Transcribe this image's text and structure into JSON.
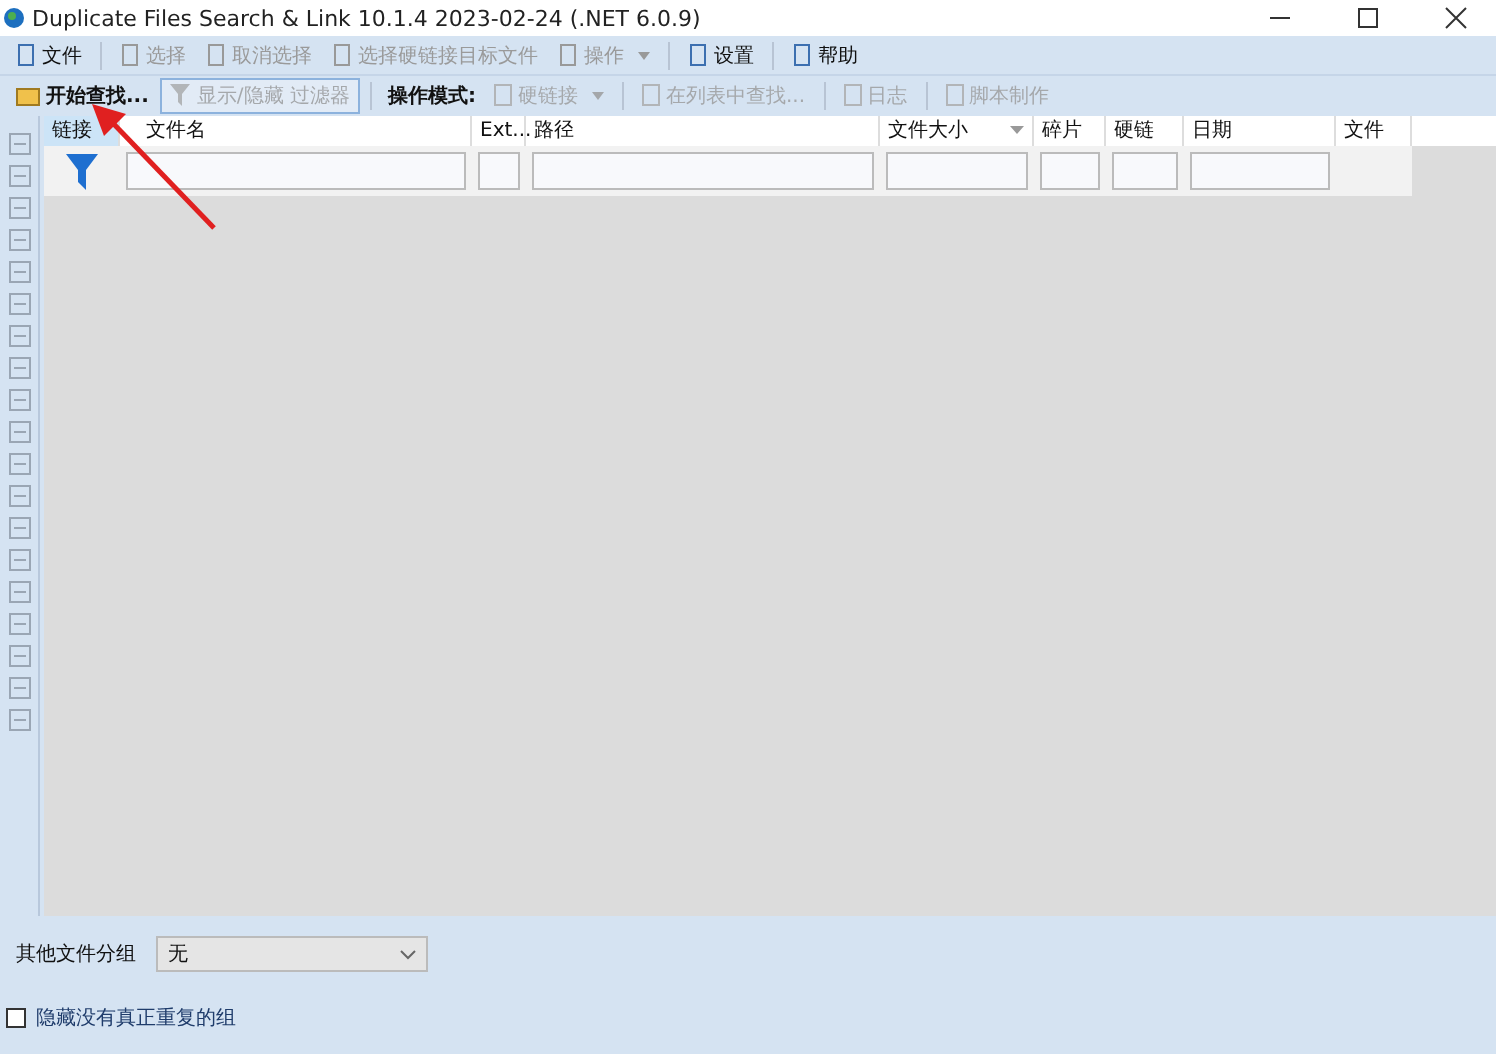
{
  "window": {
    "title": "Duplicate Files Search & Link 10.1.4 2023-02-24 (.NET 6.0.9)"
  },
  "menu": [
    {
      "label": "文件",
      "disabled": false,
      "dropdown": false
    },
    {
      "label": "选择",
      "disabled": true,
      "dropdown": false
    },
    {
      "label": "取消选择",
      "disabled": true,
      "dropdown": false
    },
    {
      "label": "选择硬链接目标文件",
      "disabled": true,
      "dropdown": false
    },
    {
      "label": "操作",
      "disabled": true,
      "dropdown": true
    },
    {
      "label": "设置",
      "disabled": false,
      "dropdown": false
    },
    {
      "label": "帮助",
      "disabled": false,
      "dropdown": false
    }
  ],
  "toolbar": [
    {
      "kind": "button",
      "label": "开始查找...",
      "disabled": false,
      "dropdown": false
    },
    {
      "kind": "toggle",
      "label": "显示/隐藏 过滤器",
      "disabled": true,
      "dropdown": false
    },
    {
      "kind": "label",
      "label": "操作模式:"
    },
    {
      "kind": "button",
      "label": "硬链接",
      "disabled": true,
      "dropdown": true
    },
    {
      "kind": "button",
      "label": "在列表中查找...",
      "disabled": true,
      "dropdown": false
    },
    {
      "kind": "button",
      "label": "日志",
      "disabled": true,
      "dropdown": false
    },
    {
      "kind": "button",
      "label": "脚本制作",
      "disabled": true,
      "dropdown": false
    }
  ],
  "grid": {
    "columns": [
      {
        "label": "链接",
        "selected": true,
        "kind": "funnel",
        "sort": false
      },
      {
        "label": "文件名",
        "selected": false,
        "kind": "input",
        "sort": false
      },
      {
        "label": "Ext...",
        "selected": false,
        "kind": "input",
        "sort": false
      },
      {
        "label": "路径",
        "selected": false,
        "kind": "input",
        "sort": false
      },
      {
        "label": "文件大小",
        "selected": false,
        "kind": "input",
        "sort": true
      },
      {
        "label": "碎片",
        "selected": false,
        "kind": "input",
        "sort": false
      },
      {
        "label": "硬链",
        "selected": false,
        "kind": "input",
        "sort": false
      },
      {
        "label": "日期",
        "selected": false,
        "kind": "input",
        "sort": false
      },
      {
        "label": "文件",
        "selected": false,
        "kind": "none",
        "sort": false
      }
    ]
  },
  "bottom": {
    "group_label": "其他文件分组",
    "group_value": "无",
    "hide_checkbox": {
      "label": "隐藏没有真正重复的组",
      "checked": false
    }
  }
}
